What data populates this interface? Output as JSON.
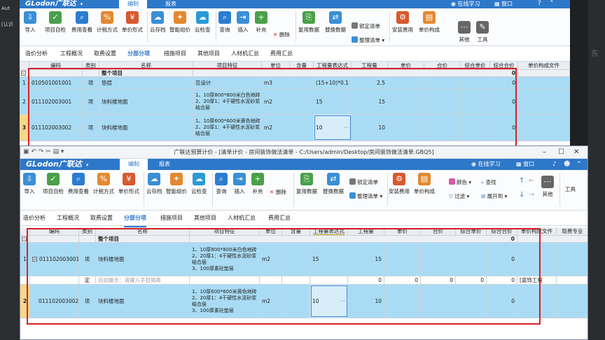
{
  "desktop": {
    "left_label": "Aut",
    "left_label2": "[认识",
    "right_label": "东"
  },
  "w1": {
    "logo": "GLodon广联达",
    "tabs": [
      "编制",
      "报表"
    ],
    "right": [
      "在线学习",
      "窗口"
    ],
    "ribbon": {
      "import": "导入",
      "self_check": "项目自检",
      "fee_view": "费用查看",
      "tax": "计税方式",
      "price_form": "单价形式",
      "cloud_save": "云存档",
      "smart_price": "智能组价",
      "cloud_check": "云检查",
      "query": "查询",
      "insert": "插入",
      "add": "补充",
      "delete": "删除",
      "reuse": "复用数据",
      "replace": "替换数据",
      "lock": "锁定清单",
      "sort": "整理清单",
      "install_fee": "安装费用",
      "unit_compose": "单价构成",
      "other": "其他",
      "tools": "工具"
    },
    "nav": [
      "造价分析",
      "工程概况",
      "取费设置",
      "分部分项",
      "措施项目",
      "其他项目",
      "人材机汇总",
      "费用汇总"
    ],
    "active_nav": "分部分项",
    "columns": [
      "编码",
      "类别",
      "名称",
      "项目特征",
      "单位",
      "含量",
      "工程量表达式",
      "工程量",
      "单价",
      "合价",
      "综合单价",
      "综合合价",
      "单价构成文件"
    ],
    "group_label": "整个项目",
    "group_total": "0",
    "rows": [
      {
        "no": "1",
        "code": "010501001001",
        "type": "项",
        "name": "垫层",
        "feature": "见设计",
        "unit": "m3",
        "expr": "(15+10)*0.1",
        "qty": "2.5",
        "total": "0"
      },
      {
        "no": "2",
        "code": "011102003001",
        "type": "项",
        "name": "块料楼地面",
        "feature": "1、10厚800*800米白色地砖\n2、20厚1：4干硬性水泥砂浆\n结合层",
        "unit": "m2",
        "expr": "15",
        "qty": "15",
        "total": "0"
      },
      {
        "no": "3",
        "code": "011102003002",
        "type": "项",
        "name": "块料楼地面",
        "feature": "1、10厚600*600米黄色地砖\n2、20厚1：4干硬性水泥砂浆\n结合层",
        "unit": "m2",
        "expr": "10",
        "qty": "10",
        "total": "0"
      }
    ]
  },
  "w2": {
    "title": "广联达预算计价 - [清单计价 - 房间装饰做法清单 - C:/Users/admin/Desktop/房间装饰做法清单.GBQ5]",
    "logo": "GLodon广联达",
    "tabs": [
      "编制",
      "报表"
    ],
    "right": [
      "在线学习",
      "窗口"
    ],
    "ribbon": {
      "import": "导入",
      "self_check": "项目自检",
      "fee_view": "费用查看",
      "tax": "计税方式",
      "price_form": "单价形式",
      "cloud_save": "云存档",
      "smart_price": "智能组价",
      "cloud_check": "云检查",
      "query": "查询",
      "insert": "插入",
      "add": "补充",
      "delete": "删除",
      "reuse": "复用数据",
      "replace": "替换数据",
      "lock": "锁定清单",
      "sort": "整理清单",
      "install_fee": "安装费用",
      "unit_compose": "单价构成",
      "color": "颜色",
      "find": "查找",
      "filter": "过滤",
      "expand": "展开到",
      "other": "其他",
      "tools": "工具"
    },
    "nav": [
      "造价分析",
      "工程概况",
      "取费设置",
      "分部分项",
      "措施项目",
      "其他项目",
      "人材机汇总",
      "费用汇总"
    ],
    "active_nav": "分部分项",
    "columns": [
      "编码",
      "类别",
      "名称",
      "项目特征",
      "单位",
      "含量",
      "工程量表达式",
      "工程量",
      "单价",
      "合价",
      "综合单价",
      "综合合价",
      "单价构成文件",
      "取费专业"
    ],
    "group_label": "整个项目",
    "group_total": "0",
    "rows": [
      {
        "no": "1",
        "code": "011102003001",
        "type": "项",
        "name": "块料楼地面",
        "feature": "1、10厚800*800米白色地砖\n2、20厚1：4干硬性水泥砂浆\n结合层\n3、100厚素砼垫层",
        "unit": "m2",
        "expr": "15",
        "qty": "15",
        "total": "0"
      },
      {
        "no": "",
        "code": "",
        "type": "定",
        "name": "自动提示：请输入子目简称",
        "feature": "",
        "unit": "",
        "expr": "",
        "qty": "0",
        "price": "0",
        "amount": "0",
        "uprice": "0",
        "total": "0",
        "file": "[装饰工程"
      },
      {
        "no": "2",
        "code": "011102003002",
        "type": "项",
        "name": "块料楼地面",
        "feature": "1、10厚600*600米黄色地砖\n2、20厚1：4干硬性水泥砂浆\n结合层\n3、100厚素砼垫层",
        "unit": "m2",
        "expr": "10",
        "qty": "10",
        "total": "0"
      }
    ]
  }
}
